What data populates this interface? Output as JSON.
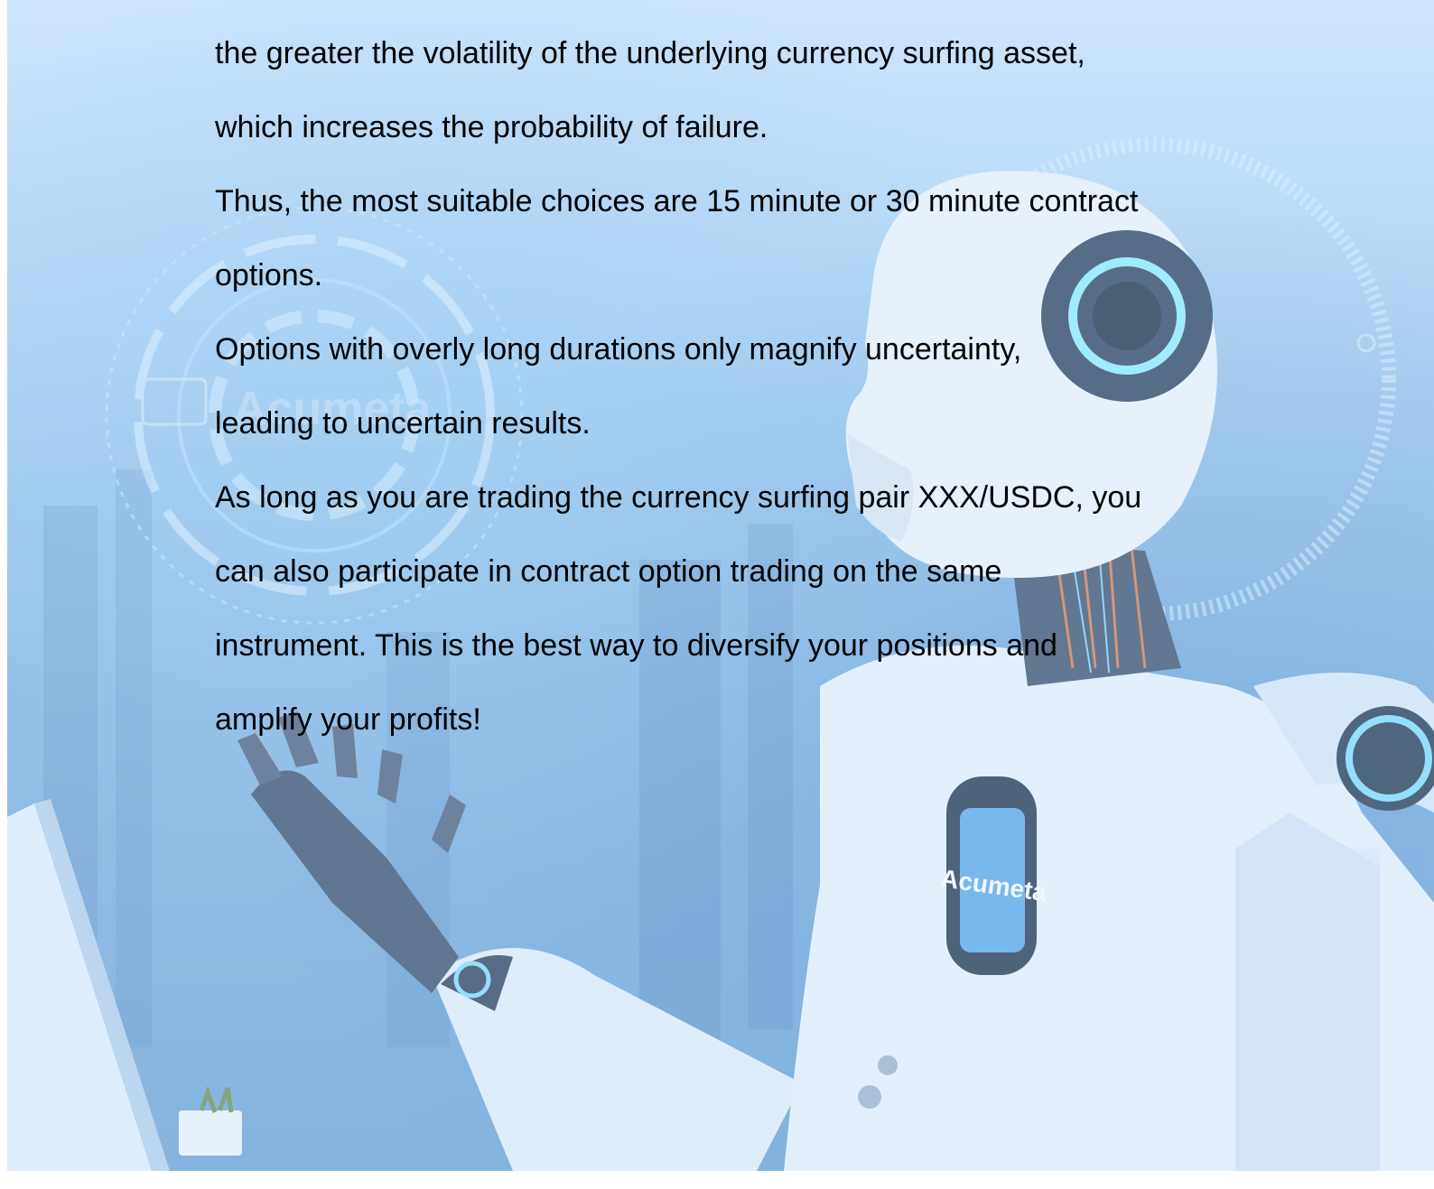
{
  "document": {
    "lines": [
      "the greater the volatility of the underlying currency surfing asset,",
      "which increases the probability of failure.",
      "Thus, the most suitable choices are 15 minute or 30 minute contract",
      "options.",
      "Options with overly long durations only magnify uncertainty,",
      "leading to uncertain results.",
      "As long as you are trading the currency surfing pair XXX/USDC, you",
      "can also participate in contract option trading on the same",
      "instrument. This is the best way to diversify your positions and",
      "amplify your profits!"
    ]
  },
  "background": {
    "description_icon": "robot-illustration",
    "watermark_logo": "Acumeta",
    "chest_logo": "Acumeta",
    "colors": {
      "sky_light": "#cfe6fb",
      "sky_mid": "#a9d1f2",
      "deep_blue": "#6aa2d4",
      "robot_white": "#eef5fc",
      "robot_dark": "#2a3f5c",
      "glow": "#7fe0ff"
    }
  }
}
